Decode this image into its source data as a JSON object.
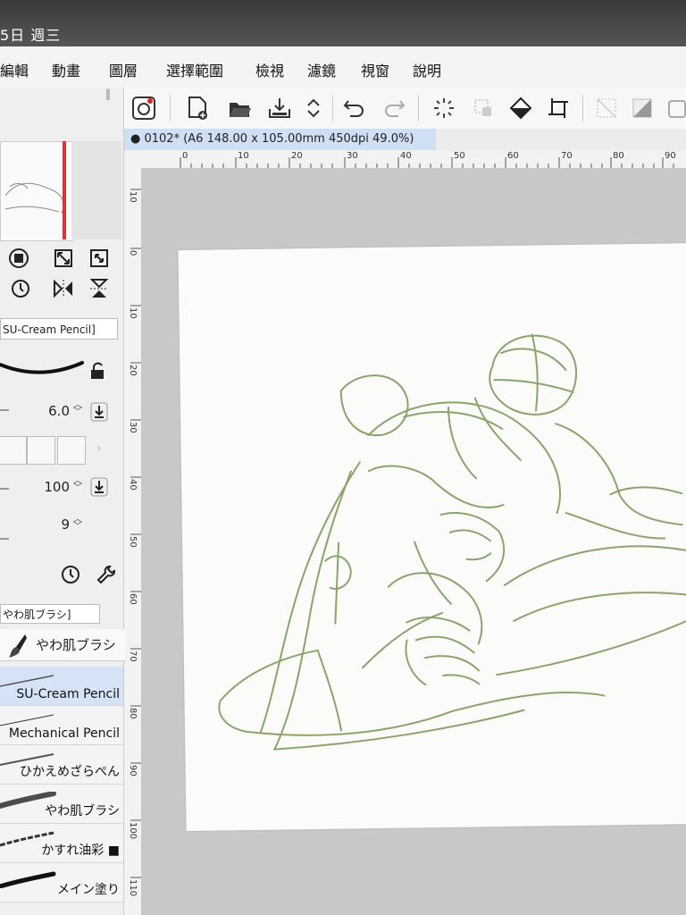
{
  "system": {
    "clock": "5日 週三"
  },
  "menu": [
    "編輯",
    "動畫",
    "圖層",
    "選擇範圍",
    "檢視",
    "濾鏡",
    "視窗",
    "說明"
  ],
  "toolbar_icons": [
    "app-logo-icon",
    "new-file-icon",
    "open-folder-icon",
    "save-icon",
    "stepper-icon",
    "undo-icon",
    "redo-icon",
    "loading-icon",
    "clear-selection-icon",
    "fill-icon",
    "crop-icon",
    "transform-icon",
    "opacity-icon",
    "frame-icon"
  ],
  "document": {
    "tab_label": "0102* (A6 148.00 x 105.00mm 450dpi 49.0%)"
  },
  "ruler": {
    "h_ticks": [
      "0",
      "10",
      "20",
      "30",
      "40",
      "50",
      "60",
      "70",
      "80",
      "90"
    ],
    "v_ticks": [
      "10",
      "0",
      "10",
      "20",
      "30",
      "40",
      "50",
      "60",
      "70",
      "80",
      "90",
      "100",
      "110"
    ]
  },
  "tool_property": {
    "brush_name": "SU-Cream Pencil]",
    "size": "6.0",
    "opacity": "100",
    "value3": "9"
  },
  "sub_tool": {
    "group_tab": "やわ肌ブラシ]",
    "active_tool": "やわ肌ブラシ",
    "brushes": [
      {
        "label": "SU-Cream Pencil",
        "selected": true
      },
      {
        "label": "Mechanical Pencil",
        "selected": false
      },
      {
        "label": "ひかえめざらぺん",
        "selected": false
      },
      {
        "label": "やわ肌ブラシ",
        "selected": false
      },
      {
        "label": "かすれ油彩 ■",
        "selected": false
      },
      {
        "label": "メイン塗り",
        "selected": false
      }
    ]
  },
  "colors": {
    "sketch_line": "#7d9c5c",
    "tab_active": "#cfe0f4",
    "selected_brush": "#d4e4f6"
  }
}
